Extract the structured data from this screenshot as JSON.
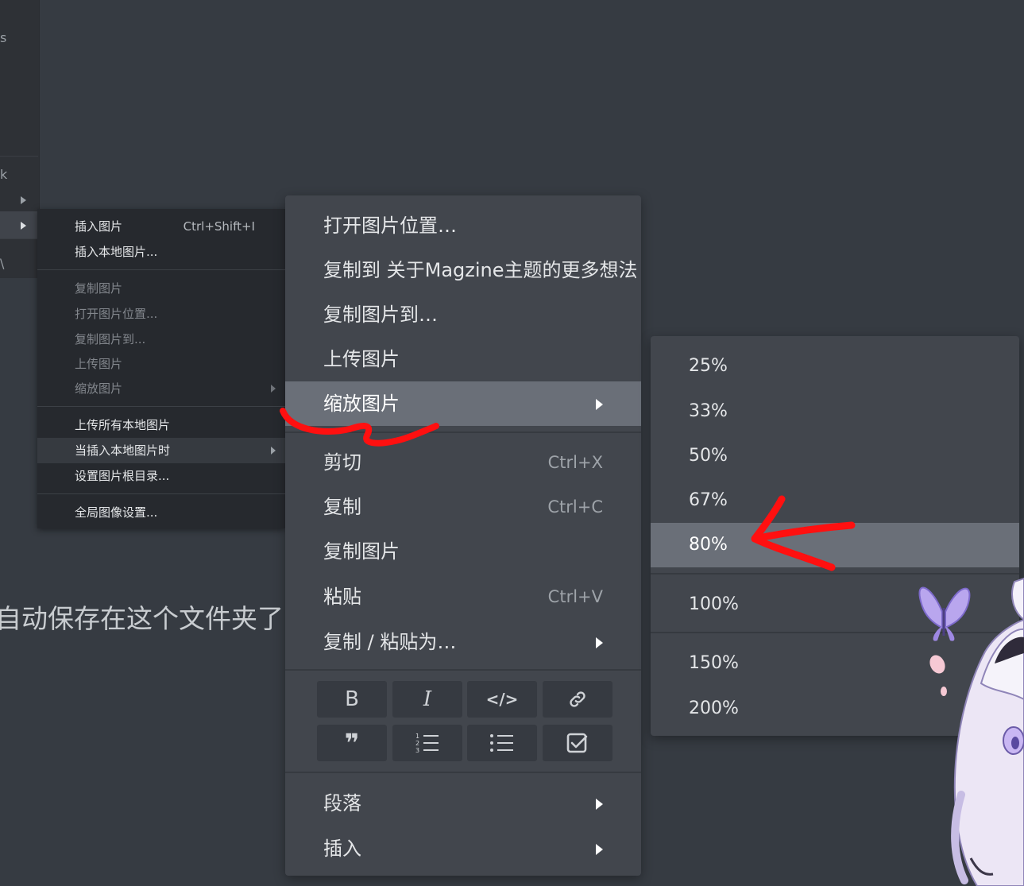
{
  "editor": {
    "text_line": "自动保存在这个文件夹了"
  },
  "image_submenu": {
    "items": [
      {
        "label": "插入图片",
        "shortcut": "Ctrl+Shift+I"
      },
      {
        "label": "插入本地图片..."
      },
      {
        "label": "复制图片"
      },
      {
        "label": "打开图片位置..."
      },
      {
        "label": "复制图片到..."
      },
      {
        "label": "上传图片"
      },
      {
        "label": "缩放图片"
      },
      {
        "label": "上传所有本地图片"
      },
      {
        "label": "当插入本地图片时"
      },
      {
        "label": "设置图片根目录..."
      },
      {
        "label": "全局图像设置..."
      }
    ]
  },
  "context_menu": {
    "items": [
      {
        "label": "打开图片位置…"
      },
      {
        "label": "复制到 关于Magzine主题的更多想法"
      },
      {
        "label": "复制图片到…"
      },
      {
        "label": "上传图片"
      },
      {
        "label": "缩放图片"
      },
      {
        "label": "剪切",
        "shortcut": "Ctrl+X"
      },
      {
        "label": "复制",
        "shortcut": "Ctrl+C"
      },
      {
        "label": "复制图片"
      },
      {
        "label": "粘贴",
        "shortcut": "Ctrl+V"
      },
      {
        "label": "复制 / 粘贴为…"
      },
      {
        "label": "段落"
      },
      {
        "label": "插入"
      }
    ],
    "format_buttons": {
      "bold": "B",
      "italic": "I",
      "code": "</>",
      "quote": "❞"
    }
  },
  "zoom_submenu": {
    "items": [
      "25%",
      "33%",
      "50%",
      "67%",
      "80%",
      "100%",
      "150%",
      "200%"
    ],
    "selected": "80%"
  },
  "colors": {
    "background": "#363b42",
    "menu": "#42464d",
    "highlight": "#6a6f78",
    "annotation_red": "#ff1010"
  }
}
